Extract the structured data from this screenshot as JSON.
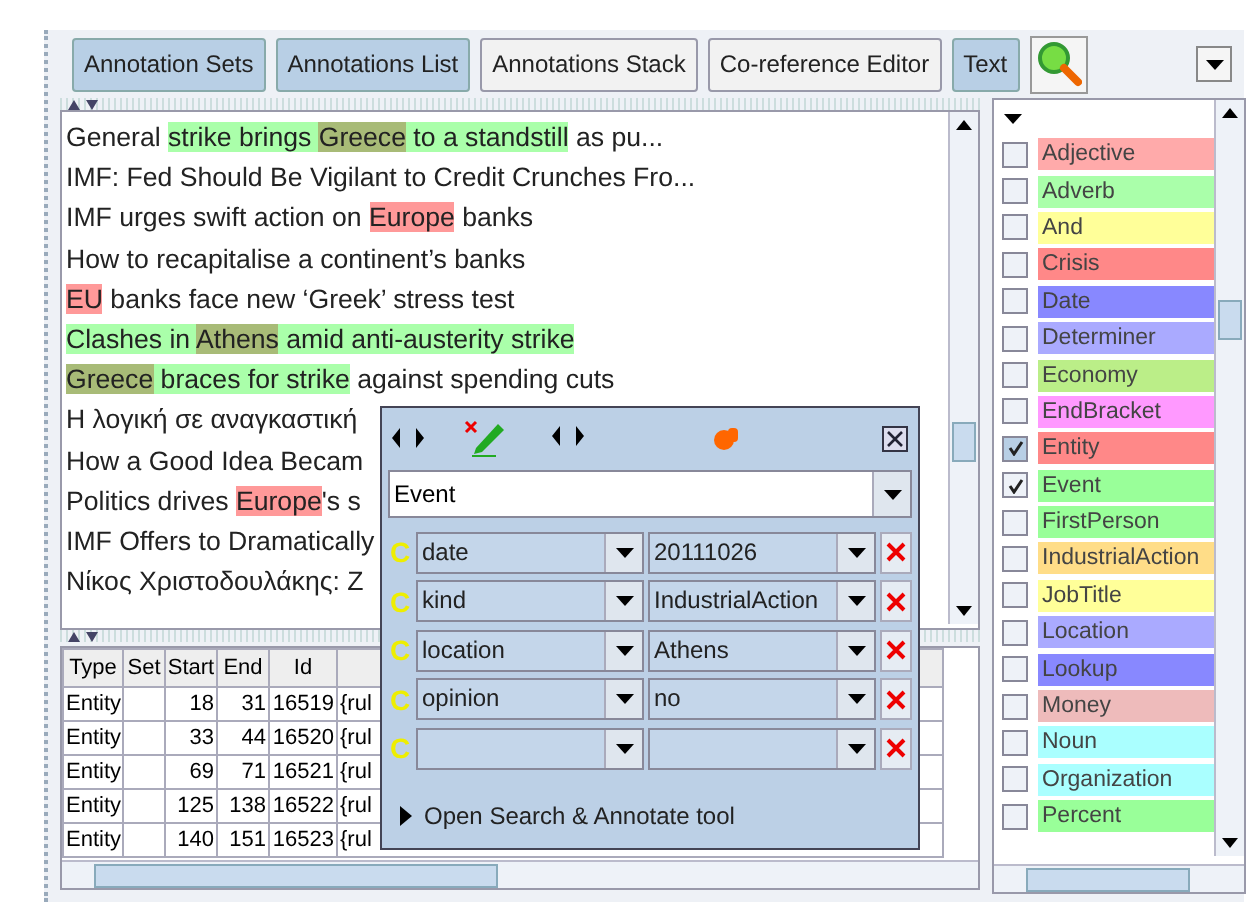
{
  "toolbar": {
    "buttons": [
      {
        "label": "Annotation Sets",
        "selected": true
      },
      {
        "label": "Annotations List",
        "selected": true
      },
      {
        "label": "Annotations Stack",
        "selected": false
      },
      {
        "label": "Co-reference Editor",
        "selected": false
      },
      {
        "label": "Text",
        "selected": true
      }
    ]
  },
  "text_lines": [
    [
      {
        "text": "General "
      },
      {
        "text": "strike brings ",
        "color": "#aaffaa"
      },
      {
        "text": "Greece",
        "color": "#a8bb77"
      },
      {
        "text": " to a standstill",
        "color": "#aaffaa"
      },
      {
        "text": " as pu..."
      }
    ],
    [
      {
        "text": "IMF: Fed Should Be Vigilant to Credit Crunches Fro..."
      }
    ],
    [
      {
        "text": "IMF urges swift action on "
      },
      {
        "text": "Europe",
        "color": "#ff9999"
      },
      {
        "text": " banks"
      }
    ],
    [
      {
        "text": "How to recapitalise a continent’s banks"
      }
    ],
    [
      {
        "text": "EU",
        "color": "#ff9999"
      },
      {
        "text": " banks face new ‘Greek’ stress test"
      }
    ],
    [
      {
        "text": "Clashes in ",
        "color": "#aaffaa"
      },
      {
        "text": "Athens",
        "color": "#a8bb77"
      },
      {
        "text": " amid anti-austerity strike",
        "color": "#aaffaa"
      }
    ],
    [
      {
        "text": "Greece",
        "color": "#a8bb77"
      },
      {
        "text": " braces for strike",
        "color": "#aaffaa"
      },
      {
        "text": " against spending cuts"
      }
    ],
    [
      {
        "text": "Η λογική σε αναγκαστική"
      }
    ],
    [
      {
        "text": "How a Good Idea Becam"
      }
    ],
    [
      {
        "text": "Politics drives "
      },
      {
        "text": "Europe",
        "color": "#ff9999"
      },
      {
        "text": "'s s"
      }
    ],
    [
      {
        "text": "IMF Offers to Dramatically"
      }
    ],
    [
      {
        "text": "Νίκος Χριστοδουλάκης: Ζ"
      }
    ]
  ],
  "table": {
    "columns": [
      "Type",
      "Set",
      "Start",
      "End",
      "Id"
    ],
    "rows": [
      [
        "Entity",
        "",
        "18",
        "31",
        "16519",
        "{rul"
      ],
      [
        "Entity",
        "",
        "33",
        "44",
        "16520",
        "{rul"
      ],
      [
        "Entity",
        "",
        "69",
        "71",
        "16521",
        "{rul"
      ],
      [
        "Entity",
        "",
        "125",
        "138",
        "16522",
        "{rul"
      ],
      [
        "Entity",
        "",
        "140",
        "151",
        "16523",
        "{rul"
      ]
    ]
  },
  "annotation_types": [
    {
      "label": "Adjective",
      "color": "#ffaaaa",
      "checked": false,
      "selected": false
    },
    {
      "label": "Adverb",
      "color": "#aaffaa",
      "checked": false,
      "selected": false
    },
    {
      "label": "And",
      "color": "#ffff99",
      "checked": false,
      "selected": false
    },
    {
      "label": "Crisis",
      "color": "#ff8888",
      "checked": false,
      "selected": false
    },
    {
      "label": "Date",
      "color": "#8888ff",
      "checked": false,
      "selected": false
    },
    {
      "label": "Determiner",
      "color": "#aaaaff",
      "checked": false,
      "selected": false
    },
    {
      "label": "Economy",
      "color": "#bbee88",
      "checked": false,
      "selected": false
    },
    {
      "label": "EndBracket",
      "color": "#ff99ff",
      "checked": false,
      "selected": false
    },
    {
      "label": "Entity",
      "color": "#ff8888",
      "checked": true,
      "selected": true
    },
    {
      "label": "Event",
      "color": "#99ff99",
      "checked": true,
      "selected": false
    },
    {
      "label": "FirstPerson",
      "color": "#99ff99",
      "checked": false,
      "selected": false
    },
    {
      "label": "IndustrialAction",
      "color": "#ffdd88",
      "checked": false,
      "selected": false
    },
    {
      "label": "JobTitle",
      "color": "#ffff99",
      "checked": false,
      "selected": false
    },
    {
      "label": "Location",
      "color": "#aaaaff",
      "checked": false,
      "selected": false
    },
    {
      "label": "Lookup",
      "color": "#8888ff",
      "checked": false,
      "selected": false
    },
    {
      "label": "Money",
      "color": "#eebbbb",
      "checked": false,
      "selected": false
    },
    {
      "label": "Noun",
      "color": "#aaffff",
      "checked": false,
      "selected": false
    },
    {
      "label": "Organization",
      "color": "#aaffff",
      "checked": false,
      "selected": false
    },
    {
      "label": "Percent",
      "color": "#99ff99",
      "checked": false,
      "selected": false
    }
  ],
  "editor_popup": {
    "type": "Event",
    "features": [
      {
        "mark": "C",
        "name": "date",
        "value": "20111026"
      },
      {
        "mark": "C",
        "name": "kind",
        "value": "IndustrialAction"
      },
      {
        "mark": "C",
        "name": "location",
        "value": "Athens"
      },
      {
        "mark": "C",
        "name": "opinion",
        "value": "no"
      },
      {
        "mark": "C"
      }
    ],
    "footer": "Open Search & Annotate tool"
  }
}
